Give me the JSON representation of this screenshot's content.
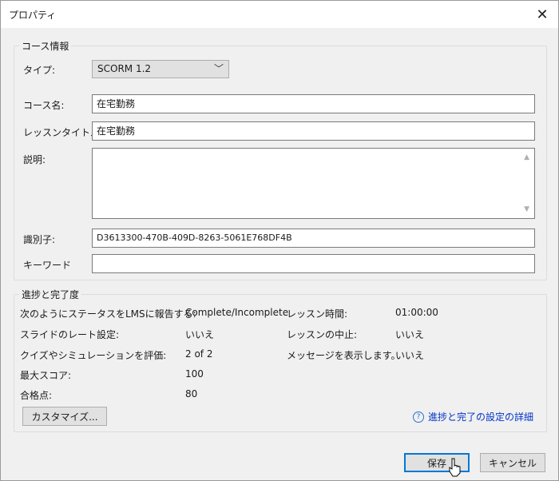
{
  "window": {
    "title": "プロパティ",
    "close_glyph": "✕"
  },
  "course_info": {
    "section_title": "コース情報",
    "type_label": "タイプ:",
    "type_value": "SCORM 1.2",
    "course_name_label": "コース名:",
    "course_name_value": "在宅勤務",
    "lesson_title_label": "レッスンタイトル",
    "lesson_title_value": "在宅勤務",
    "description_label": "説明:",
    "description_value": "",
    "identifier_label": "識別子:",
    "identifier_value": "D3613300-470B-409D-8263-5061E768DF4B",
    "keyword_label": "キーワード",
    "keyword_value": ""
  },
  "progress": {
    "section_title": "進捗と完了度",
    "report_status_label": "次のようにステータスをLMSに報告する:",
    "report_status_value": "Complete/Incomplete",
    "slide_rate_label": "スライドのレート設定:",
    "slide_rate_value": "いいえ",
    "quiz_eval_label": "クイズやシミュレーションを評価:",
    "quiz_eval_value": "2 of 2",
    "max_score_label": "最大スコア:",
    "max_score_value": "100",
    "passing_label": "合格点:",
    "passing_value": "80",
    "lesson_time_label": "レッスン時間:",
    "lesson_time_value": "01:00:00",
    "lesson_abort_label": "レッスンの中止:",
    "lesson_abort_value": "いいえ",
    "show_message_label": "メッセージを表示します。",
    "show_message_value": "いいえ",
    "customize_label": "カスタマイズ...",
    "help_link_label": "進捗と完了の設定の詳細"
  },
  "footer": {
    "save_label": "保存",
    "cancel_label": "キャンセル"
  },
  "colors": {
    "accent": "#0078d7",
    "link": "#0033cc",
    "background": "#f0f0f0"
  },
  "icons": [
    "close-icon",
    "chevron-down-icon",
    "help-icon",
    "pointer-cursor-icon"
  ]
}
